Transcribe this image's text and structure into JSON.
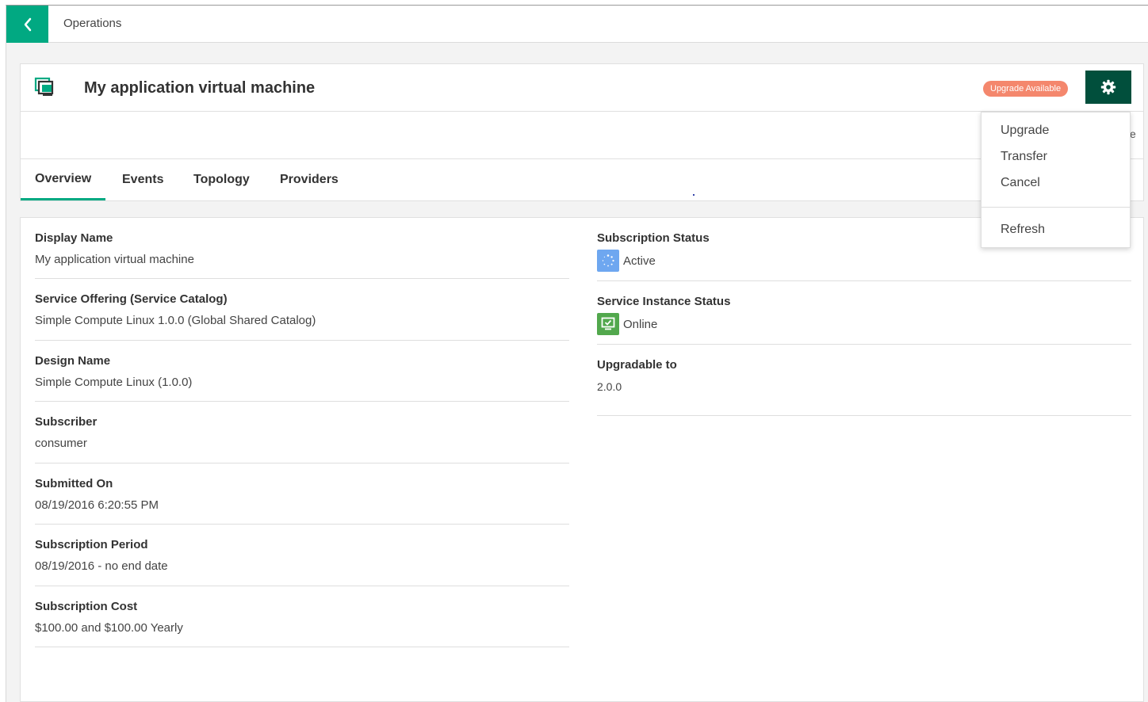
{
  "topbar": {
    "breadcrumb": "Operations",
    "back_icon": "chevron-left-icon"
  },
  "header": {
    "title": "My application virtual machine",
    "icon": "virtual-machine-icon",
    "badge": "Upgrade Available",
    "settings_icon": "gear-icon"
  },
  "tabs": [
    {
      "label": "Overview",
      "active": true
    },
    {
      "label": "Events",
      "active": false
    },
    {
      "label": "Topology",
      "active": false
    },
    {
      "label": "Providers",
      "active": false
    }
  ],
  "details_left": [
    {
      "label": "Display Name",
      "value": "My application virtual machine"
    },
    {
      "label": "Service Offering (Service Catalog)",
      "value": "Simple Compute Linux 1.0.0 (Global Shared Catalog)"
    },
    {
      "label": "Design Name",
      "value": "Simple Compute Linux (1.0.0)"
    },
    {
      "label": "Subscriber",
      "value": "consumer"
    },
    {
      "label": "Submitted On",
      "value": "08/19/2016 6:20:55 PM"
    },
    {
      "label": "Subscription Period",
      "value": "08/19/2016 - no end date"
    },
    {
      "label": "Subscription Cost",
      "value": "$100.00 and $100.00 Yearly"
    }
  ],
  "details_right": [
    {
      "label": "Subscription Status",
      "value": "Active",
      "icon": "active-status-icon"
    },
    {
      "label": "Service Instance Status",
      "value": "Online",
      "icon": "online-status-icon"
    },
    {
      "label": "Upgradable to",
      "value": "2.0.0"
    }
  ],
  "menu": {
    "items": [
      "Upgrade",
      "Transfer",
      "Cancel"
    ],
    "refresh": "Refresh"
  },
  "clipped_text": "e",
  "colors": {
    "brand_green": "#01a982",
    "dark_green": "#014f3c",
    "badge_orange": "#f4876d",
    "active_blue": "#6ea7f0",
    "online_green": "#52a84d"
  }
}
